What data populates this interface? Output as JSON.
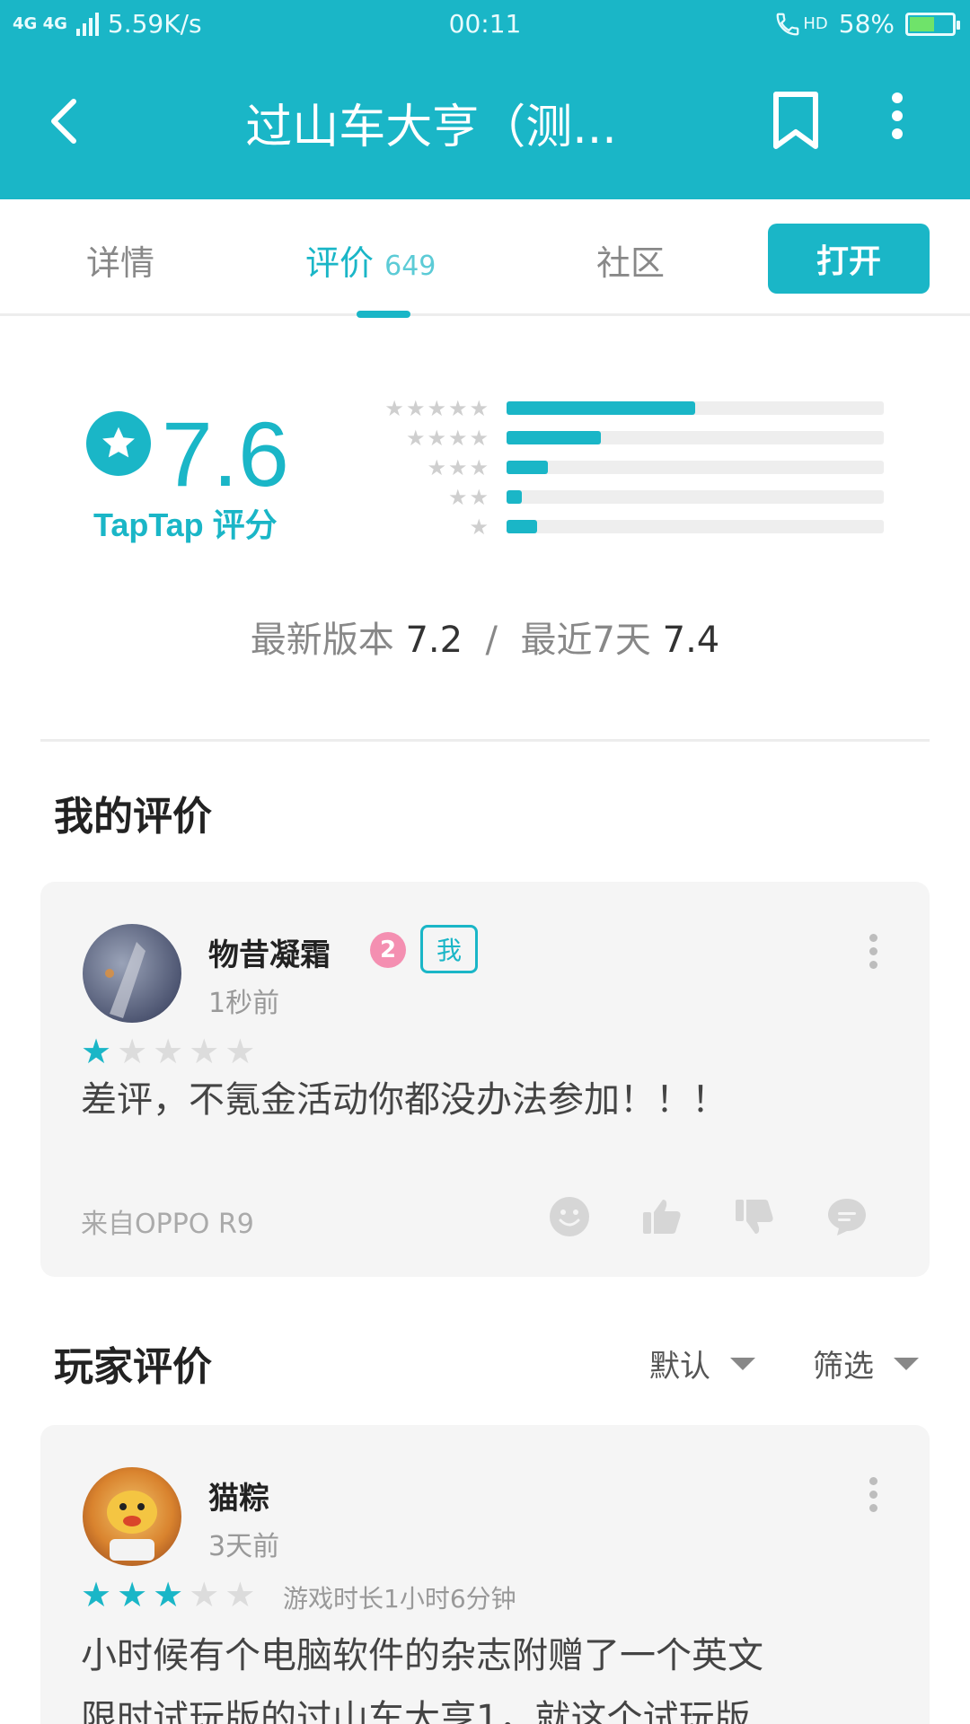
{
  "status_bar": {
    "network": "4G 4G",
    "speed": "5.59K/s",
    "time": "00:11",
    "call_label": "HD",
    "battery": "58%",
    "battery_level": 0.58
  },
  "app_bar": {
    "title": "过山车大亨（测...",
    "icons": [
      "back-arrow-icon",
      "bookmark-icon",
      "more-vertical-icon"
    ]
  },
  "tabs": {
    "details": "详情",
    "reviews": "评价",
    "reviews_count": "649",
    "community": "社区",
    "open_button": "打开"
  },
  "rating": {
    "score": "7.6",
    "label": "TapTap 评分",
    "distribution": [
      {
        "stars": "★★★★★",
        "fraction": 0.5
      },
      {
        "stars": "★★★★",
        "fraction": 0.25
      },
      {
        "stars": "★★★",
        "fraction": 0.11
      },
      {
        "stars": "★★",
        "fraction": 0.04
      },
      {
        "stars": "★",
        "fraction": 0.08
      }
    ],
    "latest_version_label": "最新版本",
    "latest_version_score": "7.2",
    "separator": "/",
    "recent_label": "最近7天",
    "recent_score": "7.4"
  },
  "my_review": {
    "section_title": "我的评价",
    "user": "物昔凝霜",
    "level": "2",
    "me_badge": "我",
    "time": "1秒前",
    "stars": 1,
    "text": "差评，不氪金活动你都没办法参加！！！",
    "device": "来自OPPO R9"
  },
  "player_reviews": {
    "section_title": "玩家评价",
    "sort_label": "默认",
    "filter_label": "筛选",
    "items": [
      {
        "user": "猫粽",
        "time": "3天前",
        "stars": 3,
        "playtime": "游戏时长1小时6分钟",
        "text": "小时候有个电脑软件的杂志附赠了一个英文",
        "text2": "限时试玩版的过山车大亨1，就这个试玩版"
      }
    ]
  },
  "colors": {
    "accent": "#1ab6c7",
    "star_off": "#dcdcdc",
    "card_bg": "#f5f5f5"
  }
}
